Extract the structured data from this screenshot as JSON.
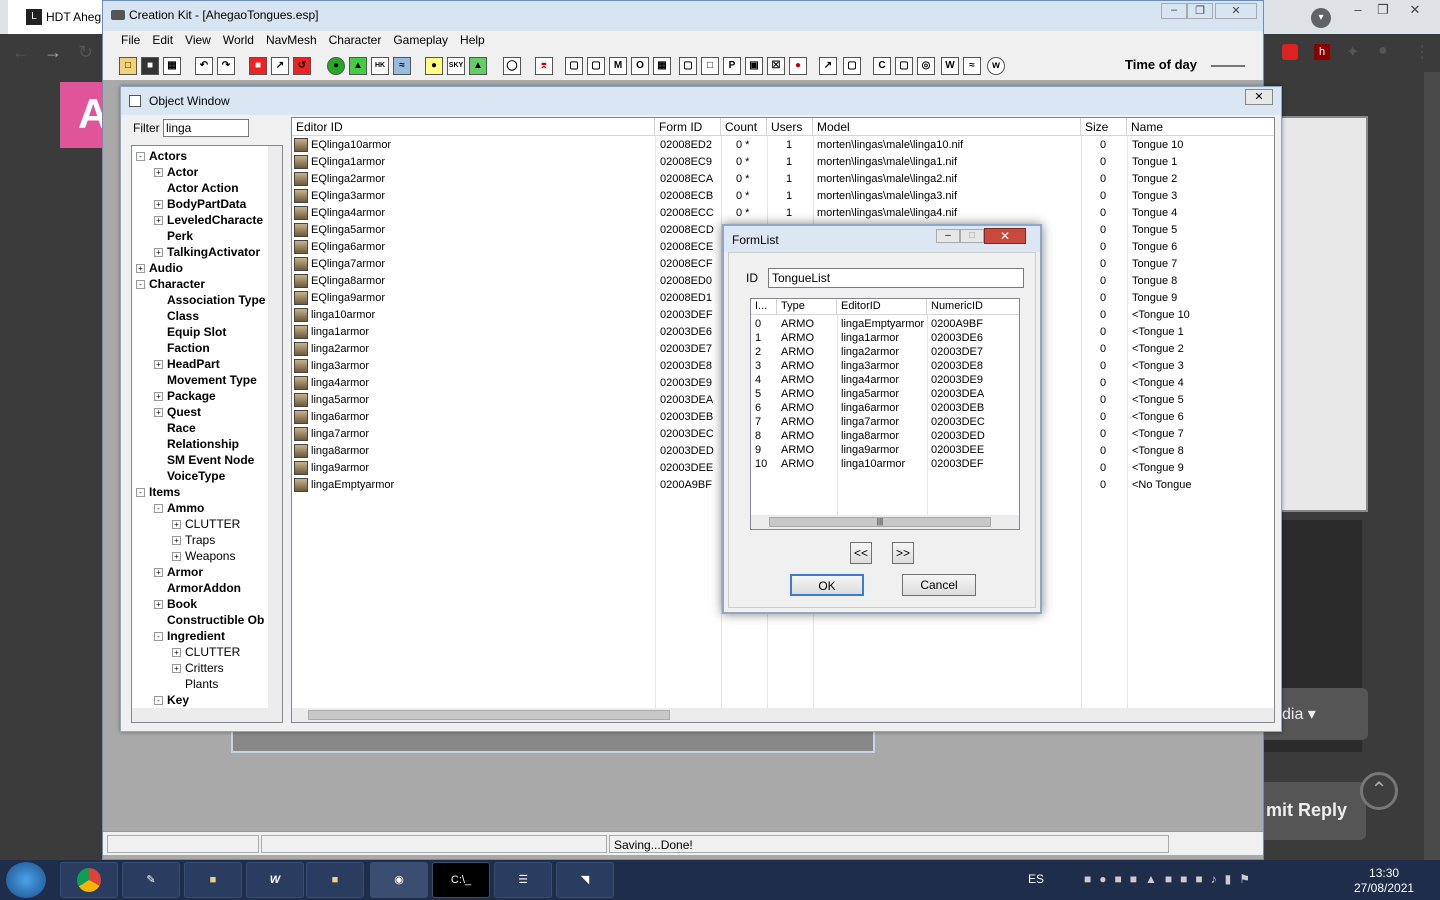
{
  "browser": {
    "tab_title": "HDT Aheg",
    "fav_letter": "L",
    "pink_letter": "A",
    "submit_label": "mit Reply",
    "media_label": "dia ▾"
  },
  "ck": {
    "title": "Creation Kit - [AhegaoTongues.esp]",
    "menu": [
      "File",
      "Edit",
      "View",
      "World",
      "NavMesh",
      "Character",
      "Gameplay",
      "Help"
    ],
    "time_of_day": "Time of day",
    "status": "Saving...Done!"
  },
  "object_window": {
    "title": "Object Window",
    "filter_label": "Filter",
    "filter_value": "linga",
    "columns": [
      "Editor ID",
      "Form ID",
      "Count",
      "Users",
      "Model",
      "Size",
      "Name"
    ],
    "rows": [
      {
        "editor_id": "EQlinga10armor",
        "form_id": "02008ED2",
        "count": "0 *",
        "users": "1",
        "model": "morten\\lingas\\male\\linga10.nif",
        "size": "0",
        "name": "Tongue 10"
      },
      {
        "editor_id": "EQlinga1armor",
        "form_id": "02008EC9",
        "count": "0 *",
        "users": "1",
        "model": "morten\\lingas\\male\\linga1.nif",
        "size": "0",
        "name": "Tongue 1"
      },
      {
        "editor_id": "EQlinga2armor",
        "form_id": "02008ECA",
        "count": "0 *",
        "users": "1",
        "model": "morten\\lingas\\male\\linga2.nif",
        "size": "0",
        "name": "Tongue 2"
      },
      {
        "editor_id": "EQlinga3armor",
        "form_id": "02008ECB",
        "count": "0 *",
        "users": "1",
        "model": "morten\\lingas\\male\\linga3.nif",
        "size": "0",
        "name": "Tongue 3"
      },
      {
        "editor_id": "EQlinga4armor",
        "form_id": "02008ECC",
        "count": "0 *",
        "users": "1",
        "model": "morten\\lingas\\male\\linga4.nif",
        "size": "0",
        "name": "Tongue 4"
      },
      {
        "editor_id": "EQlinga5armor",
        "form_id": "02008ECD",
        "count": "",
        "users": "",
        "model": "",
        "size": "0",
        "name": "Tongue 5"
      },
      {
        "editor_id": "EQlinga6armor",
        "form_id": "02008ECE",
        "count": "",
        "users": "",
        "model": "",
        "size": "0",
        "name": "Tongue 6"
      },
      {
        "editor_id": "EQlinga7armor",
        "form_id": "02008ECF",
        "count": "",
        "users": "",
        "model": "",
        "size": "0",
        "name": "Tongue 7"
      },
      {
        "editor_id": "EQlinga8armor",
        "form_id": "02008ED0",
        "count": "",
        "users": "",
        "model": "",
        "size": "0",
        "name": "Tongue 8"
      },
      {
        "editor_id": "EQlinga9armor",
        "form_id": "02008ED1",
        "count": "",
        "users": "",
        "model": "",
        "size": "0",
        "name": "Tongue 9"
      },
      {
        "editor_id": "linga10armor",
        "form_id": "02003DEF",
        "count": "",
        "users": "",
        "model": "",
        "size": "0",
        "name": "<Tongue 10"
      },
      {
        "editor_id": "linga1armor",
        "form_id": "02003DE6",
        "count": "",
        "users": "",
        "model": "",
        "size": "0",
        "name": "<Tongue 1"
      },
      {
        "editor_id": "linga2armor",
        "form_id": "02003DE7",
        "count": "",
        "users": "",
        "model": "",
        "size": "0",
        "name": "<Tongue 2"
      },
      {
        "editor_id": "linga3armor",
        "form_id": "02003DE8",
        "count": "",
        "users": "",
        "model": "",
        "size": "0",
        "name": "<Tongue 3"
      },
      {
        "editor_id": "linga4armor",
        "form_id": "02003DE9",
        "count": "",
        "users": "",
        "model": "",
        "size": "0",
        "name": "<Tongue 4"
      },
      {
        "editor_id": "linga5armor",
        "form_id": "02003DEA",
        "count": "",
        "users": "",
        "model": "",
        "size": "0",
        "name": "<Tongue 5"
      },
      {
        "editor_id": "linga6armor",
        "form_id": "02003DEB",
        "count": "",
        "users": "",
        "model": "",
        "size": "0",
        "name": "<Tongue 6"
      },
      {
        "editor_id": "linga7armor",
        "form_id": "02003DEC",
        "count": "",
        "users": "",
        "model": "",
        "size": "0",
        "name": "<Tongue 7"
      },
      {
        "editor_id": "linga8armor",
        "form_id": "02003DED",
        "count": "",
        "users": "",
        "model": "",
        "size": "0",
        "name": "<Tongue 8"
      },
      {
        "editor_id": "linga9armor",
        "form_id": "02003DEE",
        "count": "",
        "users": "",
        "model": "",
        "size": "0",
        "name": "<Tongue 9"
      },
      {
        "editor_id": "lingaEmptyarmor",
        "form_id": "0200A9BF",
        "count": "",
        "users": "",
        "model": "",
        "size": "0",
        "name": "<No Tongue"
      }
    ],
    "tree": [
      {
        "label": "Actors",
        "level": 0,
        "bold": true,
        "exp": "-"
      },
      {
        "label": "Actor",
        "level": 1,
        "bold": true,
        "exp": "+"
      },
      {
        "label": "Actor Action",
        "level": 1,
        "bold": true,
        "exp": ""
      },
      {
        "label": "BodyPartData",
        "level": 1,
        "bold": true,
        "exp": "+"
      },
      {
        "label": "LeveledCharacte",
        "level": 1,
        "bold": true,
        "exp": "+"
      },
      {
        "label": "Perk",
        "level": 1,
        "bold": true,
        "exp": ""
      },
      {
        "label": "TalkingActivator",
        "level": 1,
        "bold": true,
        "exp": "+"
      },
      {
        "label": "Audio",
        "level": 0,
        "bold": true,
        "exp": "+"
      },
      {
        "label": "Character",
        "level": 0,
        "bold": true,
        "exp": "-"
      },
      {
        "label": "Association Type",
        "level": 1,
        "bold": true,
        "exp": ""
      },
      {
        "label": "Class",
        "level": 1,
        "bold": true,
        "exp": ""
      },
      {
        "label": "Equip Slot",
        "level": 1,
        "bold": true,
        "exp": ""
      },
      {
        "label": "Faction",
        "level": 1,
        "bold": true,
        "exp": ""
      },
      {
        "label": "HeadPart",
        "level": 1,
        "bold": true,
        "exp": "+"
      },
      {
        "label": "Movement Type",
        "level": 1,
        "bold": true,
        "exp": ""
      },
      {
        "label": "Package",
        "level": 1,
        "bold": true,
        "exp": "+"
      },
      {
        "label": "Quest",
        "level": 1,
        "bold": true,
        "exp": "+"
      },
      {
        "label": "Race",
        "level": 1,
        "bold": true,
        "exp": ""
      },
      {
        "label": "Relationship",
        "level": 1,
        "bold": true,
        "exp": ""
      },
      {
        "label": "SM Event Node",
        "level": 1,
        "bold": true,
        "exp": ""
      },
      {
        "label": "VoiceType",
        "level": 1,
        "bold": true,
        "exp": ""
      },
      {
        "label": "Items",
        "level": 0,
        "bold": true,
        "exp": "-"
      },
      {
        "label": "Ammo",
        "level": 1,
        "bold": true,
        "exp": "-"
      },
      {
        "label": "CLUTTER",
        "level": 2,
        "bold": false,
        "exp": "+"
      },
      {
        "label": "Traps",
        "level": 2,
        "bold": false,
        "exp": "+"
      },
      {
        "label": "Weapons",
        "level": 2,
        "bold": false,
        "exp": "+"
      },
      {
        "label": "Armor",
        "level": 1,
        "bold": true,
        "exp": "+"
      },
      {
        "label": "ArmorAddon",
        "level": 1,
        "bold": true,
        "exp": ""
      },
      {
        "label": "Book",
        "level": 1,
        "bold": true,
        "exp": "+"
      },
      {
        "label": "Constructible Ob",
        "level": 1,
        "bold": true,
        "exp": ""
      },
      {
        "label": "Ingredient",
        "level": 1,
        "bold": true,
        "exp": "-"
      },
      {
        "label": "CLUTTER",
        "level": 2,
        "bold": false,
        "exp": "+"
      },
      {
        "label": "Critters",
        "level": 2,
        "bold": false,
        "exp": "+"
      },
      {
        "label": "Plants",
        "level": 2,
        "bold": false,
        "exp": ""
      },
      {
        "label": "Key",
        "level": 1,
        "bold": true,
        "exp": "-"
      }
    ]
  },
  "formlist": {
    "title": "FormList",
    "id_label": "ID",
    "id_value": "TongueList",
    "columns": [
      "I...",
      "Type",
      "EditorID",
      "NumericID"
    ],
    "rows": [
      {
        "i": "0",
        "type": "ARMO",
        "editor_id": "lingaEmptyarmor",
        "numeric_id": "0200A9BF"
      },
      {
        "i": "1",
        "type": "ARMO",
        "editor_id": "linga1armor",
        "numeric_id": "02003DE6"
      },
      {
        "i": "2",
        "type": "ARMO",
        "editor_id": "linga2armor",
        "numeric_id": "02003DE7"
      },
      {
        "i": "3",
        "type": "ARMO",
        "editor_id": "linga3armor",
        "numeric_id": "02003DE8"
      },
      {
        "i": "4",
        "type": "ARMO",
        "editor_id": "linga4armor",
        "numeric_id": "02003DE9"
      },
      {
        "i": "5",
        "type": "ARMO",
        "editor_id": "linga5armor",
        "numeric_id": "02003DEA"
      },
      {
        "i": "6",
        "type": "ARMO",
        "editor_id": "linga6armor",
        "numeric_id": "02003DEB"
      },
      {
        "i": "7",
        "type": "ARMO",
        "editor_id": "linga7armor",
        "numeric_id": "02003DEC"
      },
      {
        "i": "8",
        "type": "ARMO",
        "editor_id": "linga8armor",
        "numeric_id": "02003DED"
      },
      {
        "i": "9",
        "type": "ARMO",
        "editor_id": "linga9armor",
        "numeric_id": "02003DEE"
      },
      {
        "i": "10",
        "type": "ARMO",
        "editor_id": "linga10armor",
        "numeric_id": "02003DEF"
      }
    ],
    "prev_label": "<<",
    "next_label": ">>",
    "ok_label": "OK",
    "cancel_label": "Cancel"
  },
  "taskbar": {
    "language": "ES",
    "time": "13:30",
    "date": "27/08/2021"
  },
  "colors": {
    "titlebar": "#d7e4f2",
    "close_red": "#c94a3c",
    "taskbar": "#1d2d4a"
  }
}
